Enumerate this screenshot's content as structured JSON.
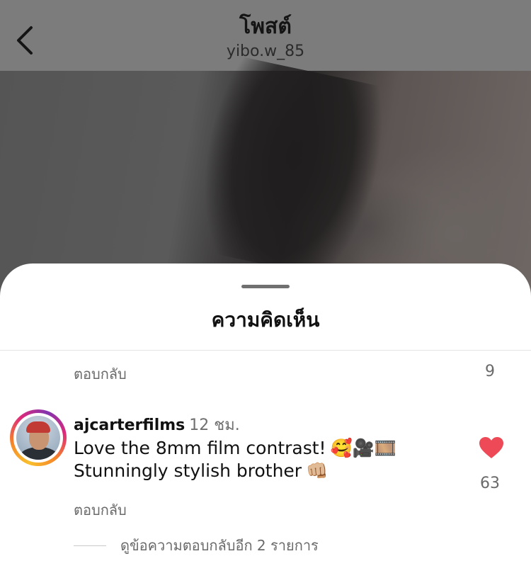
{
  "nav": {
    "title": "โพสต์",
    "subtitle": "yibo.w_85"
  },
  "sheet": {
    "title": "ความคิดเห็น",
    "top_reply_label": "ตอบกลับ",
    "top_like_count": "9"
  },
  "comment": {
    "username": "ajcarterfilms",
    "time": "12 ชม.",
    "line1": "Love the 8mm film contrast!",
    "line1_emojis": "🥰🎥🎞️",
    "line2": "Stunningly stylish brother",
    "line2_emoji": "👊🏼",
    "like_count": "63",
    "reply_label": "ตอบกลับ",
    "view_more_replies": "ดูข้อความตอบกลับอีก 2 รายการ",
    "liked": true
  },
  "colors": {
    "like": "#ed4956",
    "text": "#111111",
    "secondary": "#6a6a6a"
  },
  "icons": {
    "back": "chevron-left-icon",
    "like": "heart-filled-icon"
  }
}
